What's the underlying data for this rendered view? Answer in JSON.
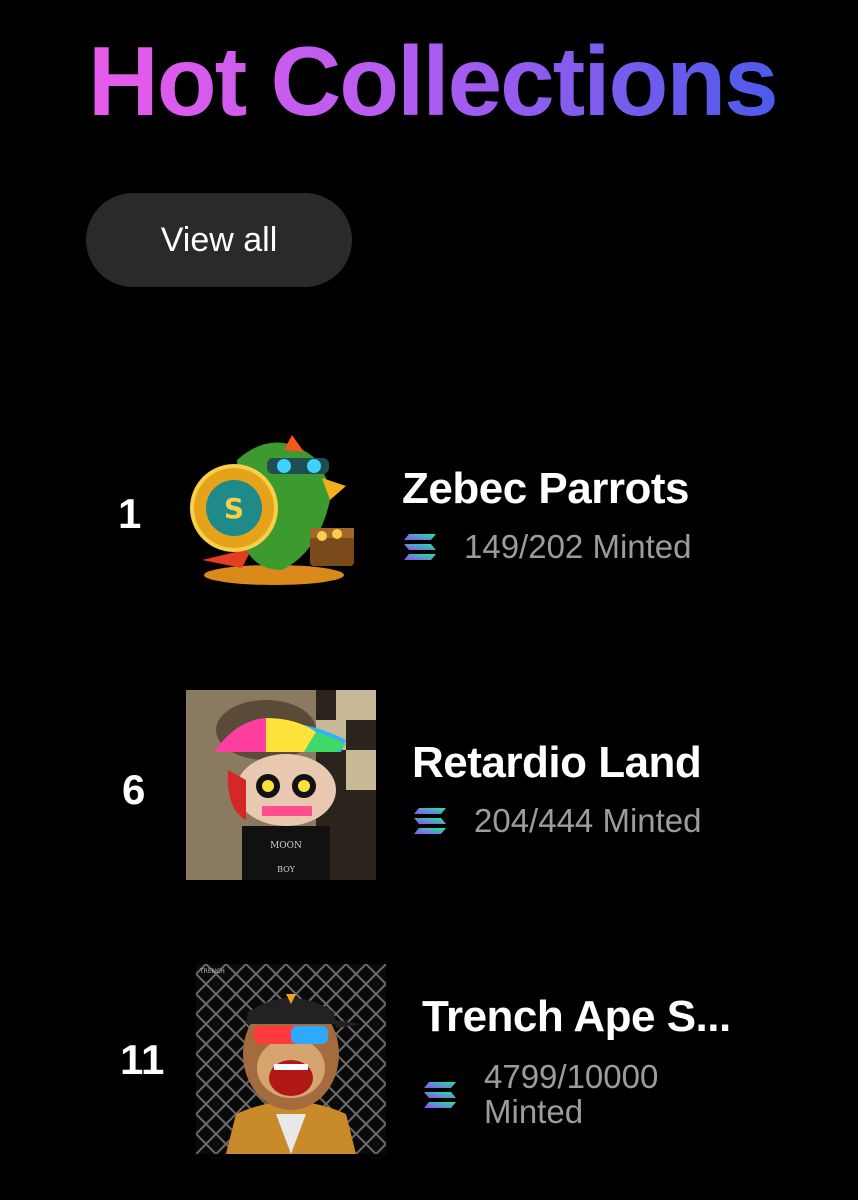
{
  "header": {
    "title": "Hot Collections",
    "view_all_label": "View all"
  },
  "collections": [
    {
      "rank": "1",
      "name": "Zebec Parrots",
      "minted": "149/202 Minted",
      "chain_icon": "solana-icon",
      "thumbnail": "zebec-parrot-thumbnail"
    },
    {
      "rank": "6",
      "name": "Retardio Land",
      "minted": "204/444 Minted",
      "chain_icon": "solana-icon",
      "thumbnail": "retardio-thumbnail"
    },
    {
      "rank": "11",
      "name": "Trench Ape S...",
      "minted_count": "4799/10000",
      "minted_suffix": "Minted",
      "chain_icon": "solana-icon",
      "thumbnail": "trench-ape-thumbnail"
    }
  ],
  "colors": {
    "title_gradient": [
      "#e95bea",
      "#b55cf0",
      "#4c5bea"
    ],
    "button_bg": "#2a2a2a",
    "muted_text": "#9c9c9c",
    "solana_gradient": [
      "#9945ff",
      "#14f195"
    ]
  }
}
